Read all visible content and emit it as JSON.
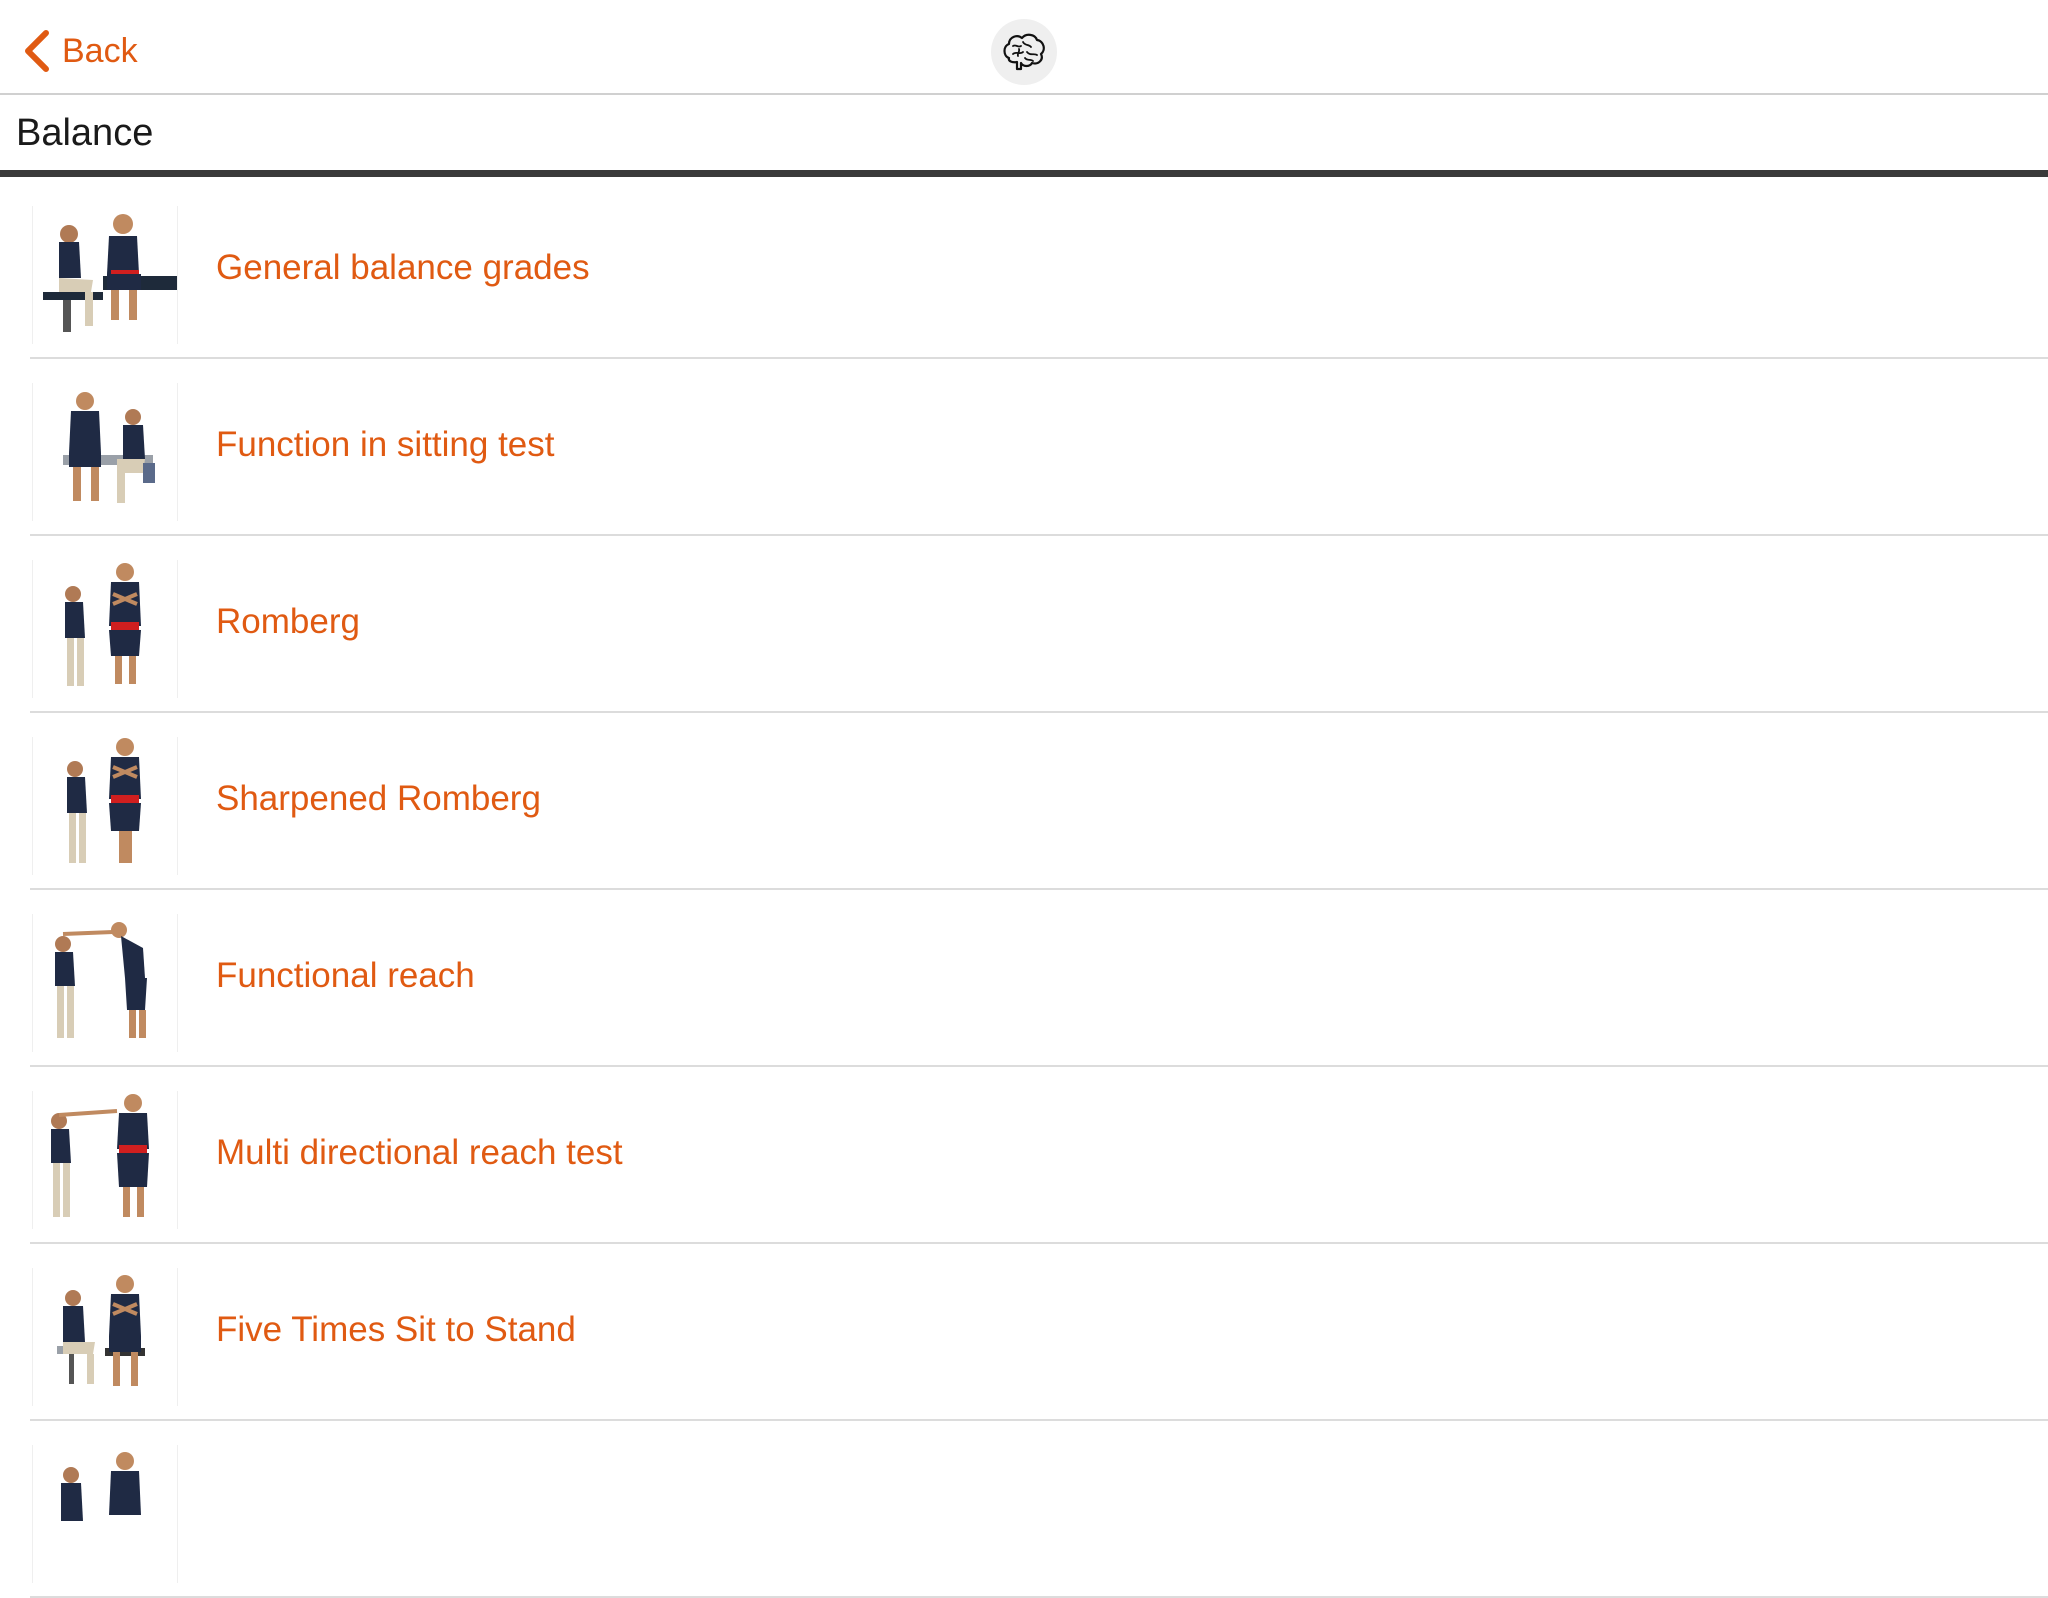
{
  "navbar": {
    "back_label": "Back",
    "logo_icon": "brain-icon",
    "accent_color": "#e05a12"
  },
  "section": {
    "title": "Balance"
  },
  "tests": [
    {
      "label": "General balance grades",
      "thumbnail": "seated-pair-table-thumbnail"
    },
    {
      "label": "Function in sitting test",
      "thumbnail": "seated-pair-thumbnail"
    },
    {
      "label": "Romberg",
      "thumbnail": "standing-pair-arms-crossed-thumbnail"
    },
    {
      "label": "Sharpened Romberg",
      "thumbnail": "standing-pair-tandem-thumbnail"
    },
    {
      "label": "Functional reach",
      "thumbnail": "forward-reach-thumbnail"
    },
    {
      "label": "Multi directional reach test",
      "thumbnail": "lateral-reach-thumbnail"
    },
    {
      "label": "Five Times Sit to Stand",
      "thumbnail": "sit-to-stand-pair-thumbnail"
    },
    {
      "label": "",
      "thumbnail": "standing-pair-thumbnail"
    }
  ]
}
